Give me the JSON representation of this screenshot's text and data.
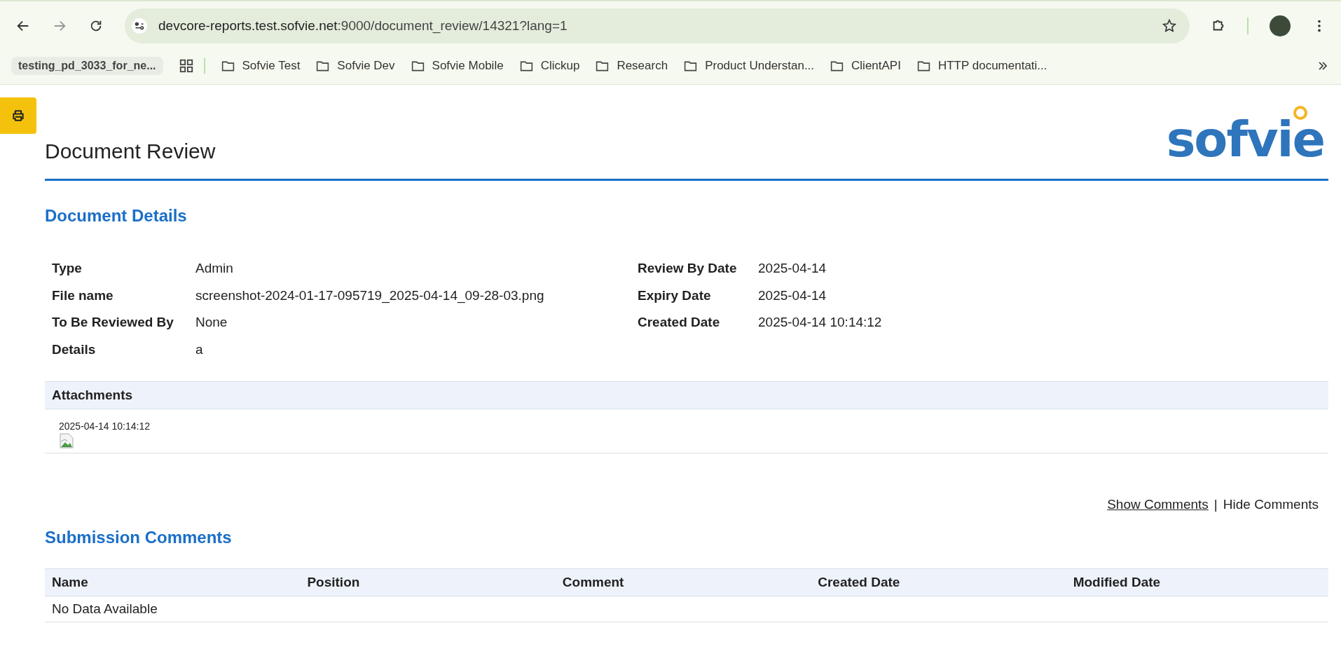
{
  "browser": {
    "url_host": "devcore-reports.test.sofvie.net",
    "url_rest": ":9000/document_review/14321?lang=1",
    "bookmarks": [
      {
        "label": "testing_pd_3033_for_ne...",
        "kind": "tab-group"
      },
      {
        "label": "Sofvie Test",
        "kind": "folder"
      },
      {
        "label": "Sofvie Dev",
        "kind": "folder"
      },
      {
        "label": "Sofvie Mobile",
        "kind": "folder"
      },
      {
        "label": "Clickup",
        "kind": "folder"
      },
      {
        "label": "Research",
        "kind": "folder"
      },
      {
        "label": "Product Understan...",
        "kind": "folder"
      },
      {
        "label": "ClientAPI",
        "kind": "folder"
      },
      {
        "label": "HTTP documentati...",
        "kind": "folder"
      }
    ]
  },
  "page": {
    "title": "Document Review",
    "logo": "sofvie",
    "details_heading": "Document Details",
    "details_left": [
      {
        "label": "Type",
        "value": "Admin"
      },
      {
        "label": "File name",
        "value": "screenshot-2024-01-17-095719_2025-04-14_09-28-03.png"
      },
      {
        "label": "To Be Reviewed By",
        "value": "None"
      },
      {
        "label": "Details",
        "value": "a"
      }
    ],
    "details_right": [
      {
        "label": "Review By Date",
        "value": "2025-04-14"
      },
      {
        "label": "Expiry Date",
        "value": "2025-04-14"
      },
      {
        "label": "Created Date",
        "value": "2025-04-14 10:14:12"
      }
    ],
    "attachments": {
      "heading": "Attachments",
      "items": [
        {
          "date": "2025-04-14 10:14:12"
        }
      ]
    },
    "comment_links": [
      {
        "label": "Show Comments ",
        "selected": true
      },
      {
        "label": "Hide Comments",
        "selected": false
      }
    ],
    "comment_separator": "|",
    "comments_heading": "Submission Comments",
    "comments_table": {
      "columns": [
        "Name",
        "Position",
        "Comment",
        "Created Date",
        "Modified Date"
      ],
      "empty_text": "No Data Available"
    }
  }
}
